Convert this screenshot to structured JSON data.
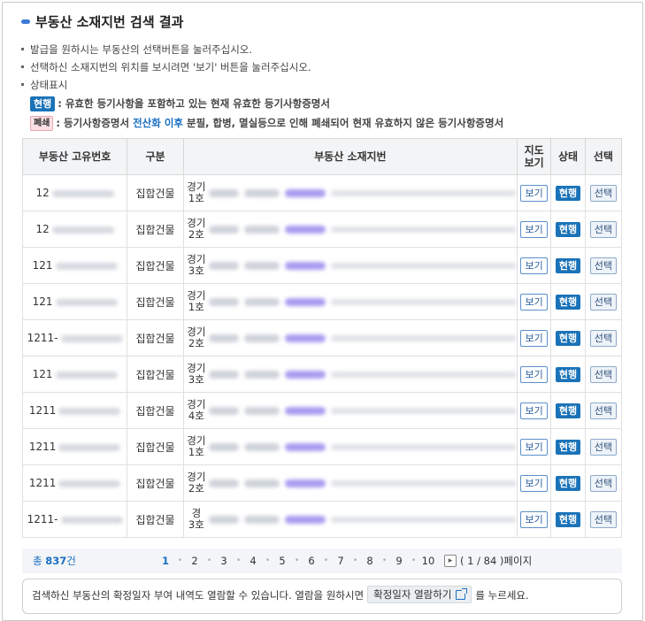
{
  "header": {
    "title": "부동산 소재지번 검색 결과"
  },
  "notes": [
    "발급을 원하시는 부동산의 선택버튼을 눌러주십시오.",
    "선택하신 소재지번의 위치를 보시려면 '보기' 버튼을 눌러주십시오.",
    "상태표시"
  ],
  "legend": {
    "current_badge": "현행",
    "current_text": ": 유효한 등기사항을 포함하고 있는 현재 유효한 등기사항증명서",
    "closed_badge": "폐쇄",
    "closed_text_a": ": 등기사항증명서",
    "closed_text_highlight": "전산화 이후",
    "closed_text_b": "분필, 합병, 멸실등으로 인해 폐쇄되어 현재 유효하지 않은 등기사항증명서"
  },
  "table": {
    "headers": {
      "uid": "부동산 고유번호",
      "type": "구분",
      "address": "부동산 소재지번",
      "map_line1": "지도",
      "map_line2": "보기",
      "status": "상태",
      "select": "선택"
    },
    "rows": [
      {
        "uid": "12",
        "type": "집합건물",
        "addr_line1": "경기",
        "addr_line2": "1호",
        "map": "보기",
        "status": "현행",
        "select": "선택"
      },
      {
        "uid": "12",
        "type": "집합건물",
        "addr_line1": "경기",
        "addr_line2": "2호",
        "map": "보기",
        "status": "현행",
        "select": "선택"
      },
      {
        "uid": "121",
        "type": "집합건물",
        "addr_line1": "경기",
        "addr_line2": "3호",
        "map": "보기",
        "status": "현행",
        "select": "선택"
      },
      {
        "uid": "121",
        "type": "집합건물",
        "addr_line1": "경기",
        "addr_line2": "1호",
        "map": "보기",
        "status": "현행",
        "select": "선택"
      },
      {
        "uid": "1211-",
        "type": "집합건물",
        "addr_line1": "경기",
        "addr_line2": "2호",
        "map": "보기",
        "status": "현행",
        "select": "선택"
      },
      {
        "uid": "121",
        "type": "집합건물",
        "addr_line1": "경기",
        "addr_line2": "3호",
        "map": "보기",
        "status": "현행",
        "select": "선택"
      },
      {
        "uid": "1211",
        "type": "집합건물",
        "addr_line1": "경기",
        "addr_line2": "4호",
        "map": "보기",
        "status": "현행",
        "select": "선택"
      },
      {
        "uid": "1211",
        "type": "집합건물",
        "addr_line1": "경기",
        "addr_line2": "1호",
        "map": "보기",
        "status": "현행",
        "select": "선택"
      },
      {
        "uid": "1211",
        "type": "집합건물",
        "addr_line1": "경기",
        "addr_line2": "2호",
        "map": "보기",
        "status": "현행",
        "select": "선택"
      },
      {
        "uid": "1211-",
        "type": "집합건물",
        "addr_line1": "경",
        "addr_line2": "3호",
        "map": "보기",
        "status": "현행",
        "select": "선택"
      }
    ]
  },
  "pager": {
    "total_label": "총",
    "total_count": "837",
    "total_unit": "건",
    "pages": [
      "1",
      "2",
      "3",
      "4",
      "5",
      "6",
      "7",
      "8",
      "9",
      "10"
    ],
    "current_page": "1",
    "next_icon": "chevron-right-icon",
    "page_count": "( 1 / 84 )페이지"
  },
  "info": {
    "text_before": "검색하신 부동산의 확정일자 부여 내역도 열람할 수 있습니다. 열람을 원하시면",
    "button_label": "확정일자 열람하기",
    "text_after": "를 누르세요."
  },
  "colors": {
    "accent": "#1a6fc2",
    "status_current": "#1a73b8",
    "status_closed_bg": "#fbe1e5"
  }
}
